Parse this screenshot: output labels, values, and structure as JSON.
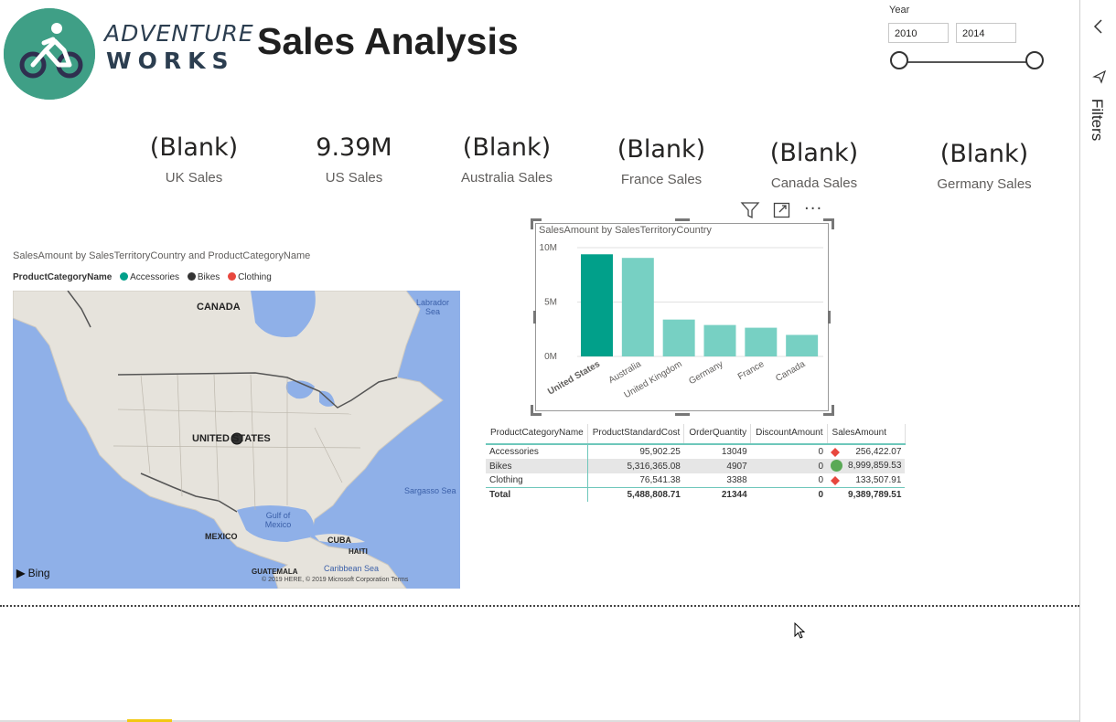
{
  "brand": {
    "line1": "ADVENTURE",
    "line2": "WORKS",
    "color": "#3f9f86"
  },
  "report_title": "Sales Analysis",
  "slicer": {
    "label": "Year",
    "from": "2010",
    "to": "2014"
  },
  "filters_pane": {
    "label": "Filters"
  },
  "kpis": [
    {
      "value": "(Blank)",
      "label": "UK Sales"
    },
    {
      "value": "9.39M",
      "label": "US Sales"
    },
    {
      "value": "(Blank)",
      "label": "Australia Sales"
    },
    {
      "value": "(Blank)",
      "label": "France Sales"
    },
    {
      "value": "(Blank)",
      "label": "Canada Sales"
    },
    {
      "value": "(Blank)",
      "label": "Germany Sales"
    }
  ],
  "map": {
    "title": "SalesAmount by SalesTerritoryCountry and ProductCategoryName",
    "legend_title": "ProductCategoryName",
    "legend": [
      {
        "name": "Accessories",
        "color": "#01a08a"
      },
      {
        "name": "Bikes",
        "color": "#333333"
      },
      {
        "name": "Clothing",
        "color": "#e8473e"
      }
    ],
    "labels": {
      "canada": "CANADA",
      "us": "UNITED STATES",
      "mexico": "MEXICO",
      "cuba": "CUBA",
      "haiti": "HAITI",
      "guatemala": "GUATEMALA",
      "labrador": "Labrador Sea",
      "sargasso": "Sargasso Sea",
      "gulf": "Gulf of Mexico",
      "caribbean": "Caribbean Sea",
      "bing": "Bing",
      "copyright": "© 2019 HERE, © 2019 Microsoft Corporation  Terms"
    }
  },
  "chart_data": {
    "type": "bar",
    "title": "SalesAmount by SalesTerritoryCountry",
    "categories": [
      "United States",
      "Australia",
      "United Kingdom",
      "Germany",
      "France",
      "Canada"
    ],
    "values": [
      9.39,
      9.06,
      3.39,
      2.89,
      2.64,
      1.98
    ],
    "ylim": [
      0,
      10
    ],
    "yticks": [
      "0M",
      "5M",
      "10M"
    ],
    "colors": {
      "selected": "#01a08a",
      "other": "#77d0c3"
    }
  },
  "table": {
    "headers": [
      "ProductCategoryName",
      "ProductStandardCost",
      "OrderQuantity",
      "DiscountAmount",
      "SalesAmount"
    ],
    "rows": [
      {
        "cells": [
          "Accessories",
          "95,902.25",
          "13049",
          "0",
          "256,422.07"
        ],
        "indicator": "diamond-red"
      },
      {
        "cells": [
          "Bikes",
          "5,316,365.08",
          "4907",
          "0",
          "8,999,859.53"
        ],
        "indicator": "circle-green"
      },
      {
        "cells": [
          "Clothing",
          "76,541.38",
          "3388",
          "0",
          "133,507.91"
        ],
        "indicator": "diamond-red"
      }
    ],
    "total": [
      "Total",
      "5,488,808.71",
      "21344",
      "0",
      "9,389,789.51"
    ]
  }
}
